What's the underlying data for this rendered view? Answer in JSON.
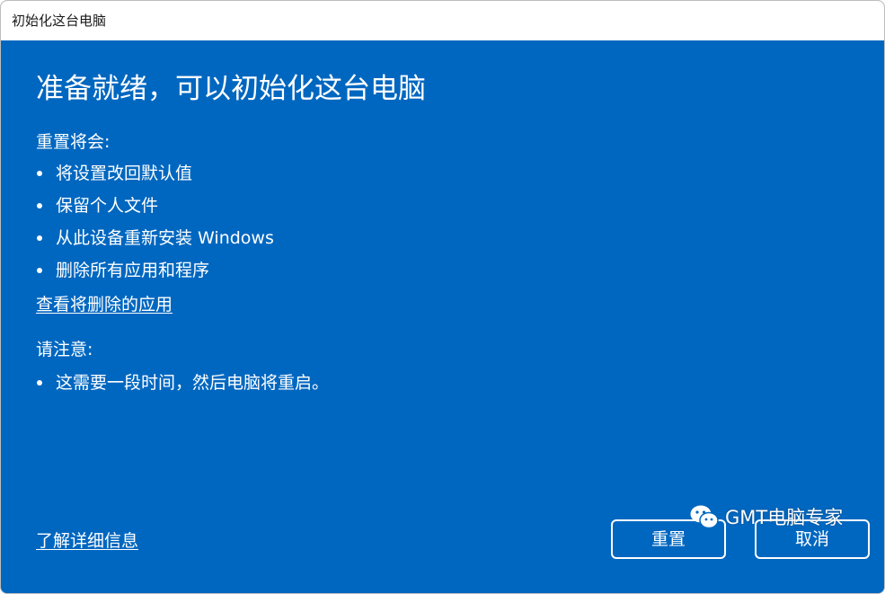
{
  "window": {
    "title": "初始化这台电脑"
  },
  "main": {
    "heading": "准备就绪，可以初始化这台电脑",
    "reset_will_label": "重置将会:",
    "reset_will_items": [
      "将设置改回默认值",
      "保留个人文件",
      "从此设备重新安装 Windows",
      "删除所有应用和程序"
    ],
    "view_apps_link": "查看将删除的应用",
    "note_label": "请注意:",
    "note_items": [
      "这需要一段时间，然后电脑将重启。"
    ]
  },
  "footer": {
    "learn_more_link": "了解详细信息",
    "reset_button": "重置",
    "cancel_button": "取消"
  },
  "watermark": {
    "text": "GMT电脑专家",
    "icon": "wechat-logo-icon"
  },
  "colors": {
    "background": "#0067c0",
    "titlebar": "#ffffff",
    "text": "#ffffff"
  }
}
